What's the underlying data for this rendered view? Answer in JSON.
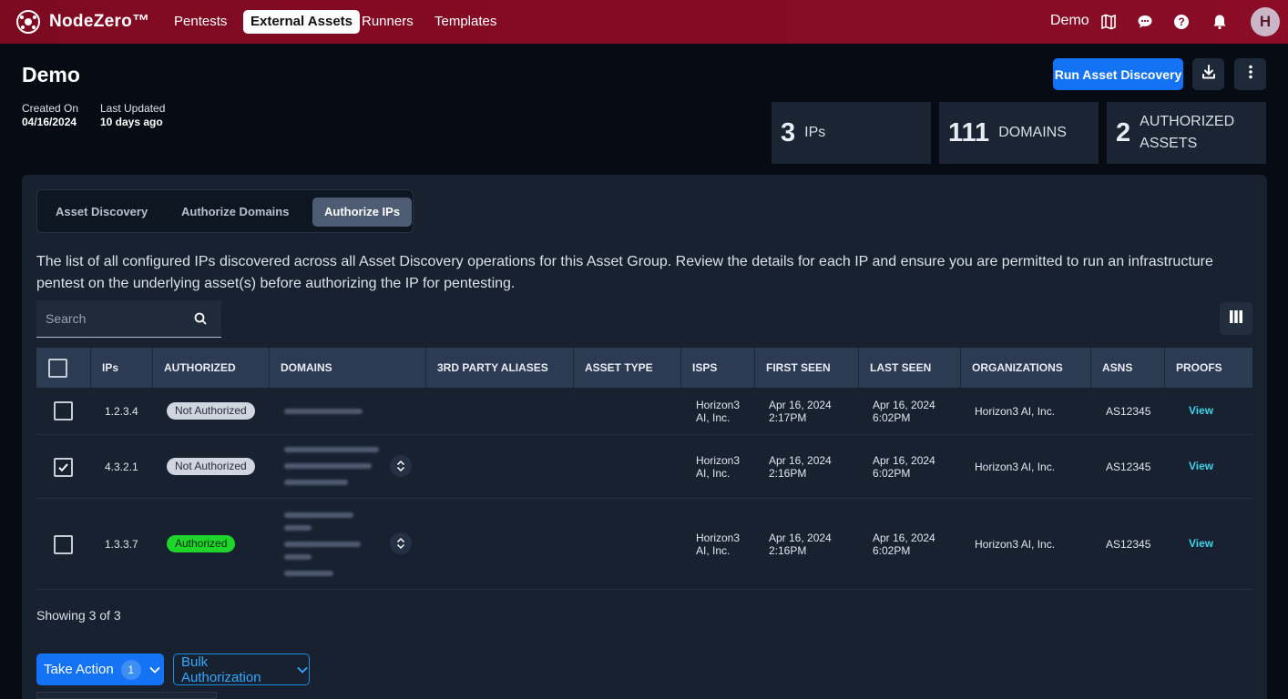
{
  "app": {
    "name": "NodeZero™"
  },
  "nav": {
    "items": [
      "Pentests",
      "External Assets",
      "Runners",
      "Templates"
    ],
    "active": "External Assets"
  },
  "topbar": {
    "workspace": "Demo",
    "avatar_initial": "H",
    "icons": [
      "map-icon",
      "chat-icon",
      "help-icon",
      "bell-icon"
    ]
  },
  "page": {
    "title": "Demo",
    "created_label": "Created On",
    "created_value": "04/16/2024",
    "updated_label": "Last Updated",
    "updated_value": "10 days ago",
    "run_button": "Run Asset Discovery"
  },
  "stats": [
    {
      "num": "3",
      "label": "IPs"
    },
    {
      "num": "111",
      "label": "DOMAINS"
    },
    {
      "num": "2",
      "label": "AUTHORIZED ASSETS"
    }
  ],
  "tabs": [
    "Asset Discovery",
    "Authorize Domains",
    "Authorize IPs"
  ],
  "active_tab": "Authorize IPs",
  "description": "The list of all configured IPs discovered across all Asset Discovery operations for this Asset Group. Review the details for each IP and ensure you are permitted to run an infrastructure pentest on the underlying asset(s) before authorizing the IP for pentesting.",
  "search": {
    "placeholder": "Search"
  },
  "table": {
    "columns": [
      "IPs",
      "AUTHORIZED",
      "DOMAINS",
      "3RD PARTY ALIASES",
      "ASSET TYPE",
      "ISPS",
      "FIRST SEEN",
      "LAST SEEN",
      "ORGANIZATIONS",
      "ASNS",
      "PROOFS"
    ],
    "rows": [
      {
        "checked": false,
        "ip": "1.2.3.4",
        "authorized": "Not Authorized",
        "isp": "Horizon3 AI, Inc.",
        "first_date": "Apr 16, 2024",
        "first_time": "2:17PM",
        "last_date": "Apr 16, 2024",
        "last_time": "6:02PM",
        "org": "Horizon3 AI, Inc.",
        "asn": "AS12345",
        "proof": "View"
      },
      {
        "checked": true,
        "ip": "4.3.2.1",
        "authorized": "Not Authorized",
        "isp": "Horizon3 AI, Inc.",
        "first_date": "Apr 16, 2024",
        "first_time": "2:16PM",
        "last_date": "Apr 16, 2024",
        "last_time": "6:02PM",
        "org": "Horizon3 AI, Inc.",
        "asn": "AS12345",
        "proof": "View"
      },
      {
        "checked": false,
        "ip": "1.3.3.7",
        "authorized": "Authorized",
        "isp": "Horizon3 AI, Inc.",
        "first_date": "Apr 16, 2024",
        "first_time": "2:16PM",
        "last_date": "Apr 16, 2024",
        "last_time": "6:02PM",
        "org": "Horizon3 AI, Inc.",
        "asn": "AS12345",
        "proof": "View"
      }
    ]
  },
  "footer": {
    "showing": "Showing 3 of 3",
    "take_action": "Take Action",
    "take_action_count": "1",
    "bulk": "Bulk Authorization"
  },
  "colors": {
    "brand": "#7e0a21",
    "primary": "#1473f5",
    "authorized": "#1fd52a",
    "link": "#40d3e8"
  }
}
